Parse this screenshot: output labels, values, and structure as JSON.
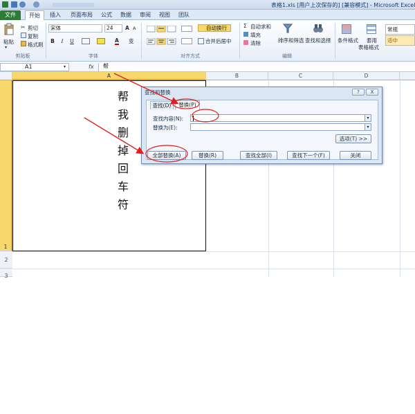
{
  "window": {
    "title": "表格1.xls [用户上次保存的] [兼容模式] - Microsoft Excel"
  },
  "ribbon_tabs": [
    "文件",
    "开始",
    "插入",
    "页面布局",
    "公式",
    "数据",
    "审阅",
    "视图",
    "团队"
  ],
  "clipboard": {
    "paste": "粘贴",
    "cut": "剪切",
    "copy": "复制",
    "format_painter": "格式刷",
    "group_label": "剪贴板"
  },
  "font": {
    "name": "宋体",
    "size": "24",
    "bold": "B",
    "italic": "I",
    "underline": "U",
    "grow": "A",
    "shrink": "A",
    "font_color_letter": "A",
    "wen": "变",
    "group_label": "字体",
    "font_color": "#c00000"
  },
  "alignment": {
    "wrap_text": "自动换行",
    "merge_center": "合并后居中",
    "group_label": "对齐方式"
  },
  "editing": {
    "autosum": "自动求和",
    "fill": "填充",
    "clear": "清除",
    "sort_filter": "排序和筛选",
    "find_select": "查找和选择",
    "group_label": "编辑"
  },
  "styles": {
    "conditional": "条件格式",
    "table_format_1": "套用",
    "table_format_2": "表格格式",
    "style_normal": "常规",
    "style_neutral": "适中"
  },
  "formula_bar": {
    "name_box": "A1",
    "fx": "fx",
    "content": "帮"
  },
  "columns": [
    "A",
    "B",
    "C",
    "D"
  ],
  "rows": [
    "1",
    "2",
    "3"
  ],
  "cell_a1_chars": [
    "帮",
    "我",
    "删",
    "掉",
    "回",
    "车",
    "符"
  ],
  "dialog": {
    "title": "查找和替换",
    "help": "?",
    "close": "X",
    "tab_find": "查找(D)",
    "tab_replace": "替换(P)",
    "find_what_label": "查找内容(N):",
    "find_what_value": "",
    "replace_with_label": "替换为(E):",
    "replace_with_value": "",
    "options": "选项(T) >>",
    "replace_all": "全部替换(A)",
    "replace": "替换(R)",
    "find_all": "查找全部(I)",
    "find_next": "查找下一个(F)",
    "close_button": "关闭"
  },
  "colors": {
    "file_tab": "#2b7c35",
    "selected_header": "#f8d86a",
    "annotation_red": "#e02020"
  }
}
